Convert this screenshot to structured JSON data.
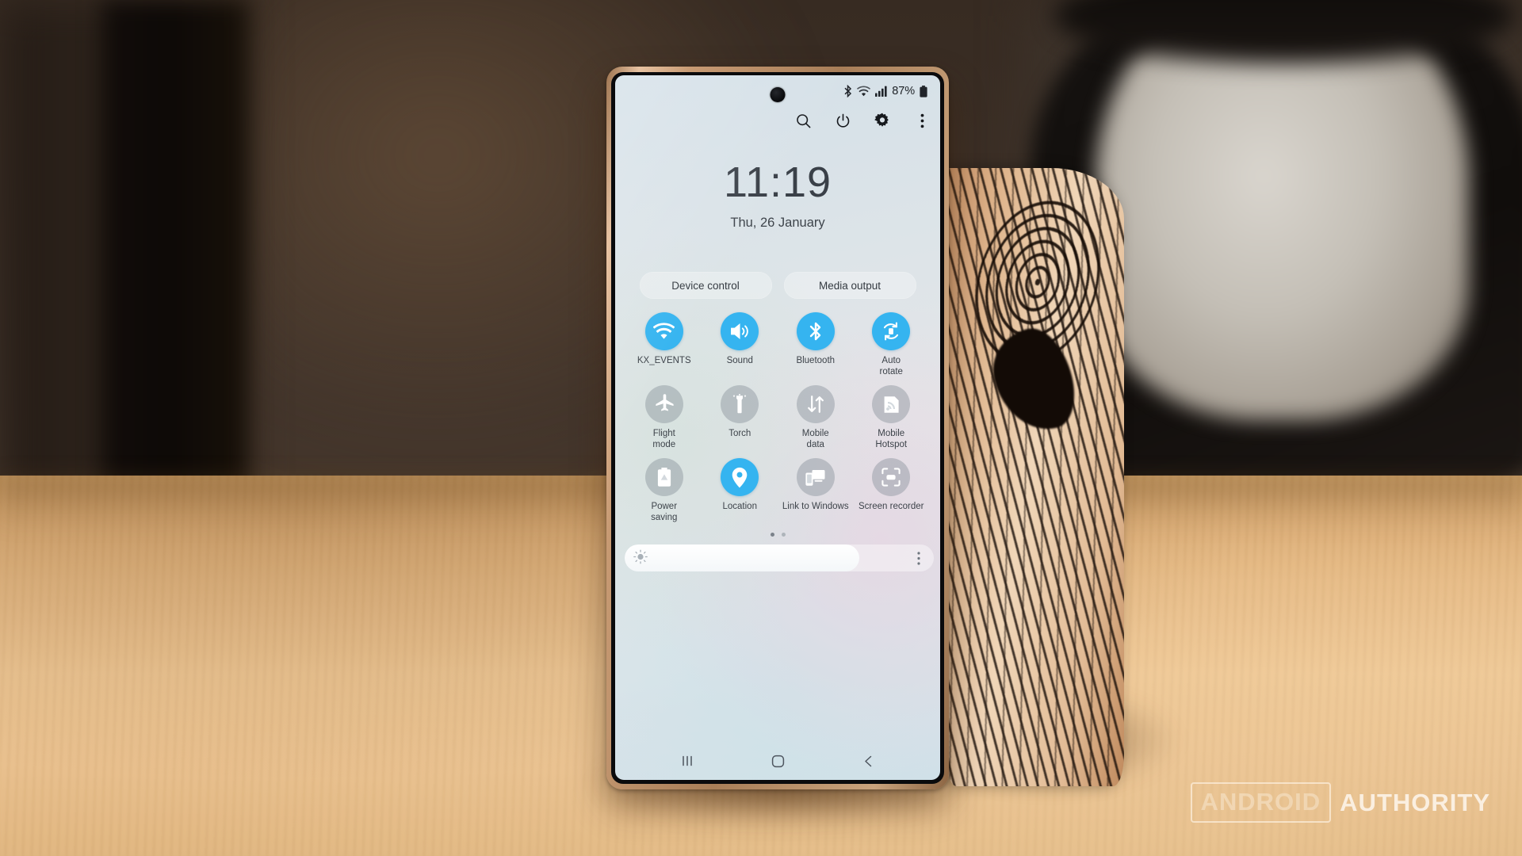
{
  "scene": {
    "device": "Samsung Galaxy smartphone",
    "surface": "light wooden table",
    "background": "blurred dark wall with dark mug and marbled ceramic vase"
  },
  "status_bar": {
    "bluetooth_icon": "bluetooth-icon",
    "wifi_icon": "wifi-icon",
    "signal_icon": "cellular-signal-icon",
    "battery_percent": "87%",
    "battery_icon": "battery-icon"
  },
  "toolbar": {
    "search_icon": "search-icon",
    "power_icon": "power-icon",
    "settings_icon": "gear-icon",
    "more_icon": "more-options-icon"
  },
  "clock": {
    "time": "11:19",
    "date": "Thu, 26 January"
  },
  "shortcuts": {
    "device_control": "Device control",
    "media_output": "Media output"
  },
  "tiles": [
    [
      {
        "label": "KX_EVENTS",
        "icon": "wifi-icon",
        "state": "on"
      },
      {
        "label": "Sound",
        "icon": "speaker-icon",
        "state": "on"
      },
      {
        "label": "Bluetooth",
        "icon": "bluetooth-icon",
        "state": "on"
      },
      {
        "label": "Auto\nrotate",
        "icon": "auto-rotate-icon",
        "state": "on"
      }
    ],
    [
      {
        "label": "Flight\nmode",
        "icon": "airplane-icon",
        "state": "off"
      },
      {
        "label": "Torch",
        "icon": "flashlight-icon",
        "state": "off"
      },
      {
        "label": "Mobile\ndata",
        "icon": "data-transfer-icon",
        "state": "off"
      },
      {
        "label": "Mobile\nHotspot",
        "icon": "hotspot-icon",
        "state": "off"
      }
    ],
    [
      {
        "label": "Power\nsaving",
        "icon": "battery-saver-icon",
        "state": "off"
      },
      {
        "label": "Location",
        "icon": "location-pin-icon",
        "state": "on"
      },
      {
        "label": "Link to Windows",
        "icon": "link-to-windows-icon",
        "state": "off"
      },
      {
        "label": "Screen recorder",
        "icon": "screen-recorder-icon",
        "state": "off"
      }
    ]
  ],
  "pagination": {
    "total": 2,
    "current": 1
  },
  "brightness": {
    "value_percent": 76,
    "sun_icon": "brightness-icon",
    "more_icon": "more-options-icon"
  },
  "nav_bar": {
    "recents": "recents-icon",
    "home": "home-icon",
    "back": "back-icon"
  },
  "watermark": {
    "boxed_word": "ANDROID",
    "plain_word": "AUTHORITY"
  },
  "colors": {
    "accent_on": "#35b4f0",
    "tile_off": "rgba(131,140,150,0.42)",
    "screen_text": "#3d434a",
    "phone_frame": "#c79a73"
  }
}
